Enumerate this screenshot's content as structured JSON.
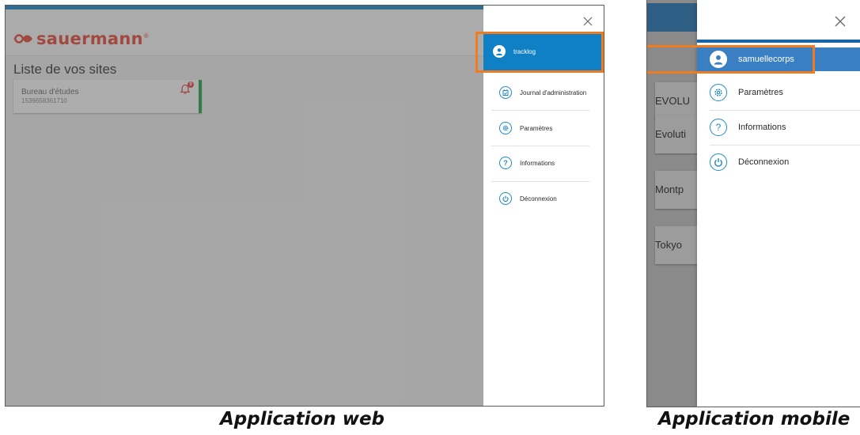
{
  "web": {
    "brand": "sauermann",
    "brand_mark": "®",
    "page_title": "Liste de vos sites",
    "site": {
      "name": "Bureau d'études",
      "id": "1536658361710",
      "alert_count": "9"
    },
    "user": "tracklog",
    "menu": [
      {
        "label": "Journal d'administration",
        "icon": "journal-icon"
      },
      {
        "label": "Paramètres",
        "icon": "gear-icon"
      },
      {
        "label": "Informations",
        "icon": "question-icon"
      },
      {
        "label": "Déconnexion",
        "icon": "power-icon"
      }
    ]
  },
  "mobile": {
    "bullet": ",",
    "user": "samuellecorps",
    "menu": [
      {
        "label": "Paramètres",
        "icon": "gear-icon"
      },
      {
        "label": "Informations",
        "icon": "question-icon"
      },
      {
        "label": "Déconnexion",
        "icon": "power-icon"
      }
    ],
    "background_sites": [
      "EVOLU",
      "Evoluti",
      "Montp",
      "Tokyo"
    ]
  },
  "captions": {
    "web": "Application web",
    "mobile": "Application mobile"
  },
  "colors": {
    "accent_blue": "#0f7fc6",
    "mobile_blue": "#3b7fc3",
    "highlight_orange": "#ef7c21",
    "brand_red": "#e44b3c",
    "status_green": "#22a84a"
  }
}
